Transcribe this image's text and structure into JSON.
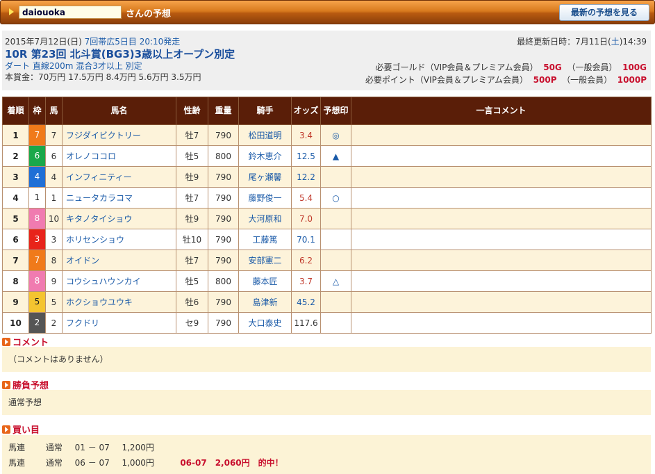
{
  "header": {
    "username": "daiouoka",
    "suffix": "さんの予想",
    "latest_button": "最新の予想を見る"
  },
  "race": {
    "date": "2015年7月12日(日)",
    "venue_link": "7回帯広5日目 20:10発走",
    "updated_prefix": "最終更新日時：7月11日(",
    "updated_day": "土",
    "updated_suffix": ")14:39",
    "name": "10R 第23回 北斗賞(BG3)3歳以上オープン別定",
    "conditions": "ダート 直線200m 混合3才以上 別定",
    "prize": "本賞金：70万円 17.5万円 8.4万円 5.6万円 3.5万円",
    "gold_label": "必要ゴールド（VIP会員＆プレミアム会員）",
    "gold_vip": "50G",
    "gold_general_label": "（一般会員）",
    "gold_general": "100G",
    "point_label": "必要ポイント（VIP会員＆プレミアム会員）",
    "point_vip": "500P",
    "point_general_label": "（一般会員）",
    "point_general": "1000P"
  },
  "table": {
    "headers": [
      "着順",
      "枠",
      "馬",
      "馬名",
      "性齢",
      "重量",
      "騎手",
      "オッズ",
      "予想印",
      "一言コメント"
    ],
    "rows": [
      {
        "rank": "1",
        "frame": "7",
        "num": "7",
        "name": "フジダイビクトリー",
        "sexage": "牡7",
        "weight": "790",
        "jockey": "松田道明",
        "odds": "3.4",
        "mark": "◎",
        "comment": ""
      },
      {
        "rank": "2",
        "frame": "6",
        "num": "6",
        "name": "オレノココロ",
        "sexage": "牡5",
        "weight": "800",
        "jockey": "鈴木恵介",
        "odds": "12.5",
        "mark": "▲",
        "comment": ""
      },
      {
        "rank": "3",
        "frame": "4",
        "num": "4",
        "name": "インフィニティー",
        "sexage": "牡9",
        "weight": "790",
        "jockey": "尾ヶ瀬馨",
        "odds": "12.2",
        "mark": "",
        "comment": ""
      },
      {
        "rank": "4",
        "frame": "1",
        "num": "1",
        "name": "ニュータカラコマ",
        "sexage": "牡7",
        "weight": "790",
        "jockey": "藤野俊一",
        "odds": "5.4",
        "mark": "○",
        "comment": ""
      },
      {
        "rank": "5",
        "frame": "8",
        "num": "10",
        "name": "キタノタイショウ",
        "sexage": "牡9",
        "weight": "790",
        "jockey": "大河原和",
        "odds": "7.0",
        "mark": "",
        "comment": ""
      },
      {
        "rank": "6",
        "frame": "3",
        "num": "3",
        "name": "ホリセンショウ",
        "sexage": "牡10",
        "weight": "790",
        "jockey": "工藤篤",
        "odds": "70.1",
        "mark": "",
        "comment": ""
      },
      {
        "rank": "7",
        "frame": "7",
        "num": "8",
        "name": "オイドン",
        "sexage": "牡7",
        "weight": "790",
        "jockey": "安部憲二",
        "odds": "6.2",
        "mark": "",
        "comment": ""
      },
      {
        "rank": "8",
        "frame": "8",
        "num": "9",
        "name": "コウシュハウンカイ",
        "sexage": "牡5",
        "weight": "800",
        "jockey": "藤本匠",
        "odds": "3.7",
        "mark": "△",
        "comment": ""
      },
      {
        "rank": "9",
        "frame": "5",
        "num": "5",
        "name": "ホクショウユウキ",
        "sexage": "牡6",
        "weight": "790",
        "jockey": "島津新",
        "odds": "45.2",
        "mark": "",
        "comment": ""
      },
      {
        "rank": "10",
        "frame": "2",
        "num": "2",
        "name": "フクドリ",
        "sexage": "セ9",
        "weight": "790",
        "jockey": "大口泰史",
        "odds": "117.6",
        "mark": "",
        "comment": ""
      }
    ]
  },
  "colors": {
    "frame_1": "#ffffff",
    "frame_2": "#555555",
    "frame_3": "#e8231a",
    "frame_4": "#1f6fd6",
    "frame_5": "#f4c430",
    "frame_6": "#1aa84a",
    "frame_7": "#f07a1a",
    "frame_8": "#f07bb0",
    "header_bg": "#5a1e08",
    "accent_red": "#c8102e",
    "link_blue": "#1a5aa8"
  },
  "sections": {
    "comment_title": "コメント",
    "comment_body": "（コメントはありません）",
    "shoubu_title": "勝負予想",
    "shoubu_body": "通常予想",
    "buy_title": "買い目",
    "buy_rows": [
      {
        "type": "馬連",
        "kind": "通常",
        "combo": "01 － 07",
        "amount": "1,200円",
        "hit": ""
      },
      {
        "type": "馬連",
        "kind": "通常",
        "combo": "06 － 07",
        "amount": "1,000円",
        "hit": "06-07　2,060円　的中！"
      }
    ]
  }
}
